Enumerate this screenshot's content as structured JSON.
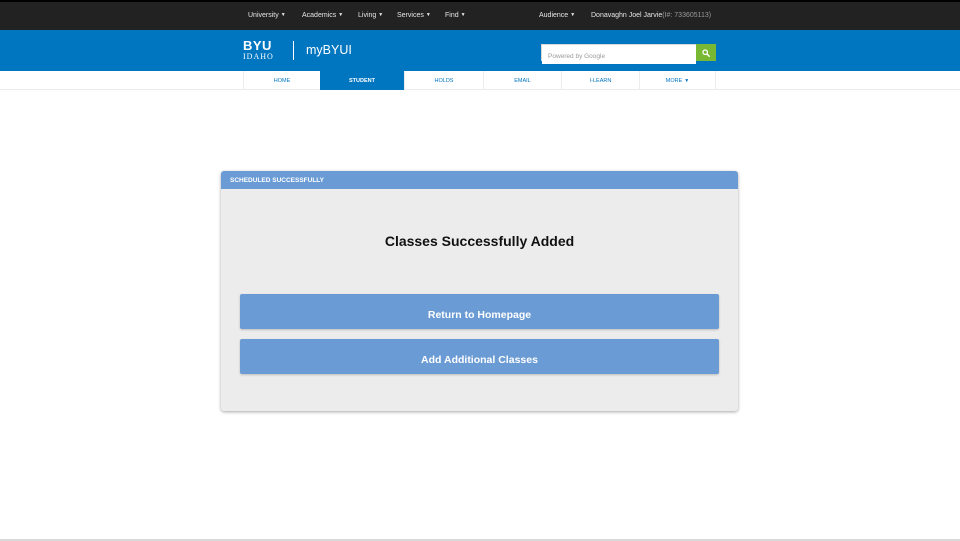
{
  "top_nav": {
    "links": [
      {
        "label": "University"
      },
      {
        "label": "Academics"
      },
      {
        "label": "Living"
      },
      {
        "label": "Services"
      },
      {
        "label": "Find"
      }
    ],
    "audience": "Audience",
    "user_name": "Donavaghn Joel Jarvie",
    "user_id": "(I#: 733605113)"
  },
  "header": {
    "logo_line1": "BYU",
    "logo_line2": "IDAHO",
    "site_title": "myBYUI",
    "search_placeholder": "Powered by Google",
    "search_value": "",
    "search_icon": "magnifier-icon",
    "header_color": "#0076c0",
    "search_button_color": "#78b833"
  },
  "nav_tabs": [
    {
      "label": "Home",
      "active": false
    },
    {
      "label": "Student",
      "active": true
    },
    {
      "label": "Holds",
      "active": false
    },
    {
      "label": "Email",
      "active": false
    },
    {
      "label": "I-Learn",
      "active": false
    },
    {
      "label": "More",
      "active": false
    }
  ],
  "card": {
    "header": "SCHEDULED SUCCESSFULLY",
    "title": "Classes Successfully Added",
    "return_button": "Return to Homepage",
    "add_button": "Add Additional Classes",
    "accent_color": "#6b9bd4"
  }
}
